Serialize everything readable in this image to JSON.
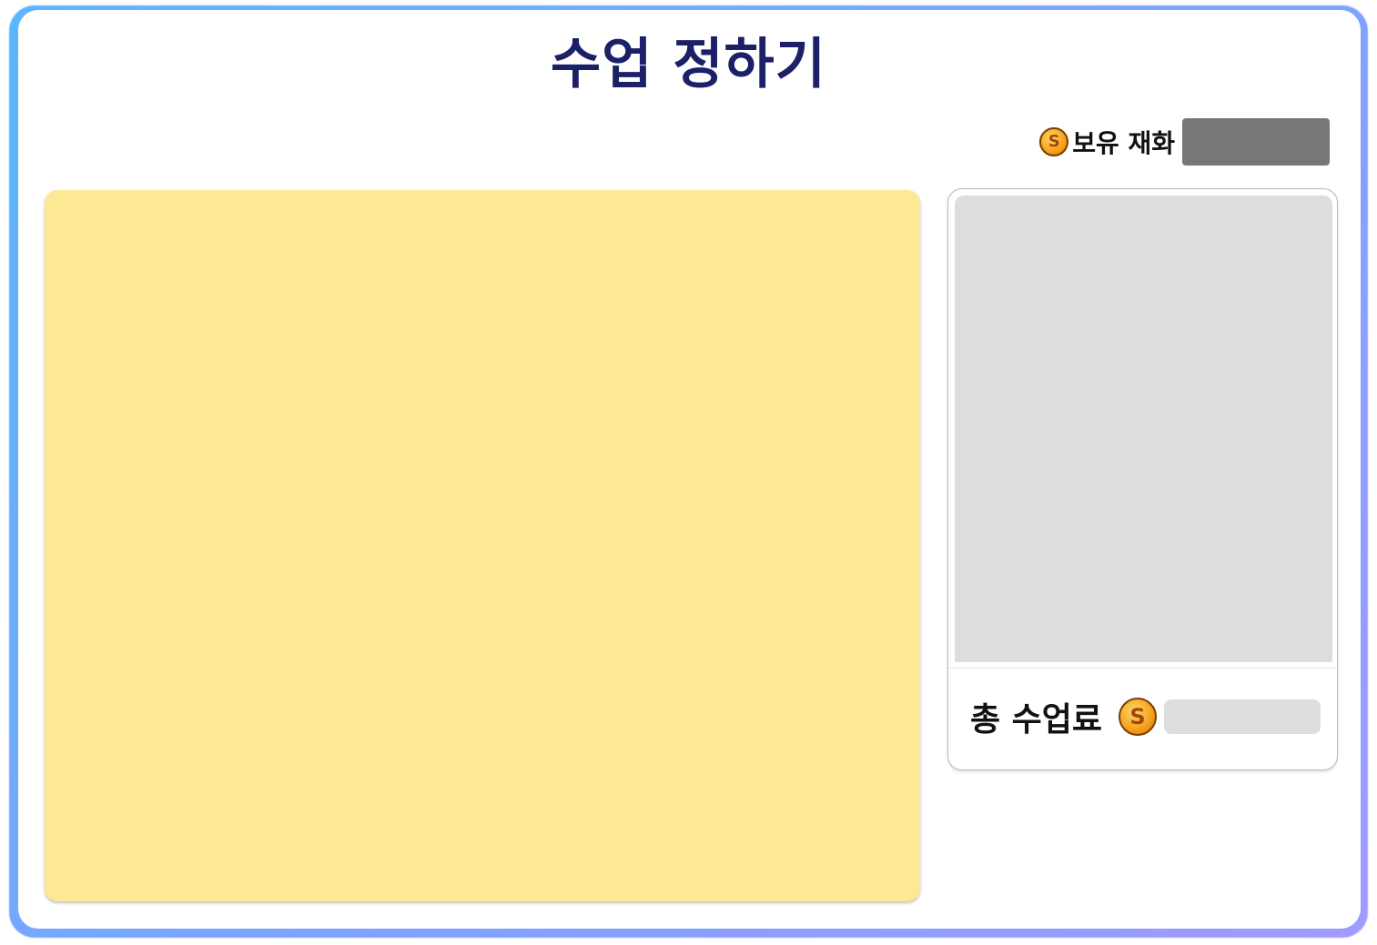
{
  "header": {
    "title": "수업 정하기"
  },
  "currency": {
    "icon": "coin-icon",
    "label": "보유 재화",
    "value": ""
  },
  "lesson_area": {
    "background_color": "#fde993"
  },
  "summary_card": {
    "image_placeholder_color": "#dcdddd",
    "fee_label": "총 수업료",
    "fee_icon": "coin-icon",
    "fee_value": ""
  },
  "colors": {
    "title": "#1b2068",
    "frame_gradient_start": "#5ab8ff",
    "frame_gradient_end": "#a59aff",
    "currency_value_bg": "#777777"
  }
}
